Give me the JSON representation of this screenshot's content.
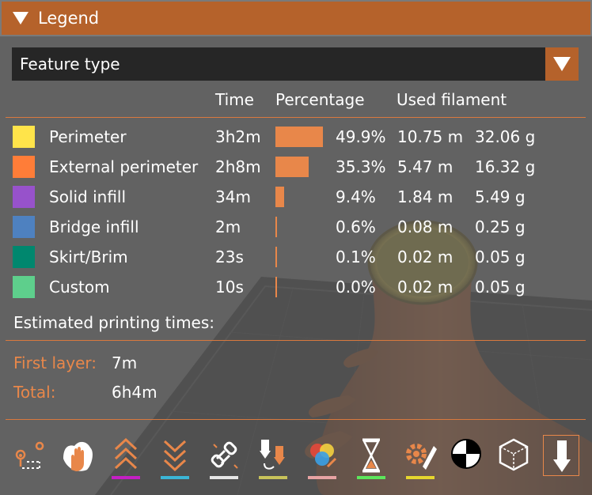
{
  "legend": {
    "title": "Legend",
    "view_type": "Feature type",
    "columns": {
      "time": "Time",
      "percentage": "Percentage",
      "used_filament": "Used filament"
    },
    "rows": [
      {
        "label": "Perimeter",
        "color": "#ffe44a",
        "time": "3h2m",
        "percent": "49.9%",
        "percent_value": 49.9,
        "length": "10.75 m",
        "weight": "32.06 g"
      },
      {
        "label": "External perimeter",
        "color": "#ff7d38",
        "time": "2h8m",
        "percent": "35.3%",
        "percent_value": 35.3,
        "length": "5.47 m",
        "weight": "16.32 g"
      },
      {
        "label": "Solid infill",
        "color": "#9752cb",
        "time": "34m",
        "percent": "9.4%",
        "percent_value": 9.4,
        "length": "1.84 m",
        "weight": "5.49 g"
      },
      {
        "label": "Bridge infill",
        "color": "#4e81c0",
        "time": "2m",
        "percent": "0.6%",
        "percent_value": 0.6,
        "length": "0.08 m",
        "weight": "0.25 g"
      },
      {
        "label": "Skirt/Brim",
        "color": "#00876e",
        "time": "23s",
        "percent": "0.1%",
        "percent_value": 0.1,
        "length": "0.02 m",
        "weight": "0.05 g"
      },
      {
        "label": "Custom",
        "color": "#5ecf8c",
        "time": "10s",
        "percent": "0.0%",
        "percent_value": 0.0,
        "length": "0.02 m",
        "weight": "0.05 g"
      }
    ],
    "estimated_label": "Estimated printing times:",
    "first_layer_label": "First layer:",
    "first_layer_value": "7m",
    "total_label": "Total:",
    "total_value": "6h4m"
  },
  "toolbar": {
    "items": [
      {
        "name": "travel-icon",
        "underline": ""
      },
      {
        "name": "wipe-icon",
        "underline": ""
      },
      {
        "name": "retractions-icon",
        "underline": "#c41fc4"
      },
      {
        "name": "deretractions-icon",
        "underline": "#3bb5d6"
      },
      {
        "name": "seams-icon",
        "underline": "#e6e6e6"
      },
      {
        "name": "tool-changes-icon",
        "underline": "#c7c25a"
      },
      {
        "name": "color-changes-icon",
        "underline": "#e8a3a3"
      },
      {
        "name": "pause-prints-icon",
        "underline": "#5ce65c"
      },
      {
        "name": "custom-gcodes-icon",
        "underline": "#e6d62e"
      },
      {
        "name": "center-of-gravity-icon",
        "underline": ""
      },
      {
        "name": "shells-icon",
        "underline": ""
      },
      {
        "name": "tool-marker-icon",
        "underline": ""
      }
    ],
    "active_index": 11
  },
  "colors": {
    "accent": "#b5622b",
    "accent_light": "#e8874a",
    "bed": "#2a2a2a",
    "model": "#9a4a1e"
  }
}
